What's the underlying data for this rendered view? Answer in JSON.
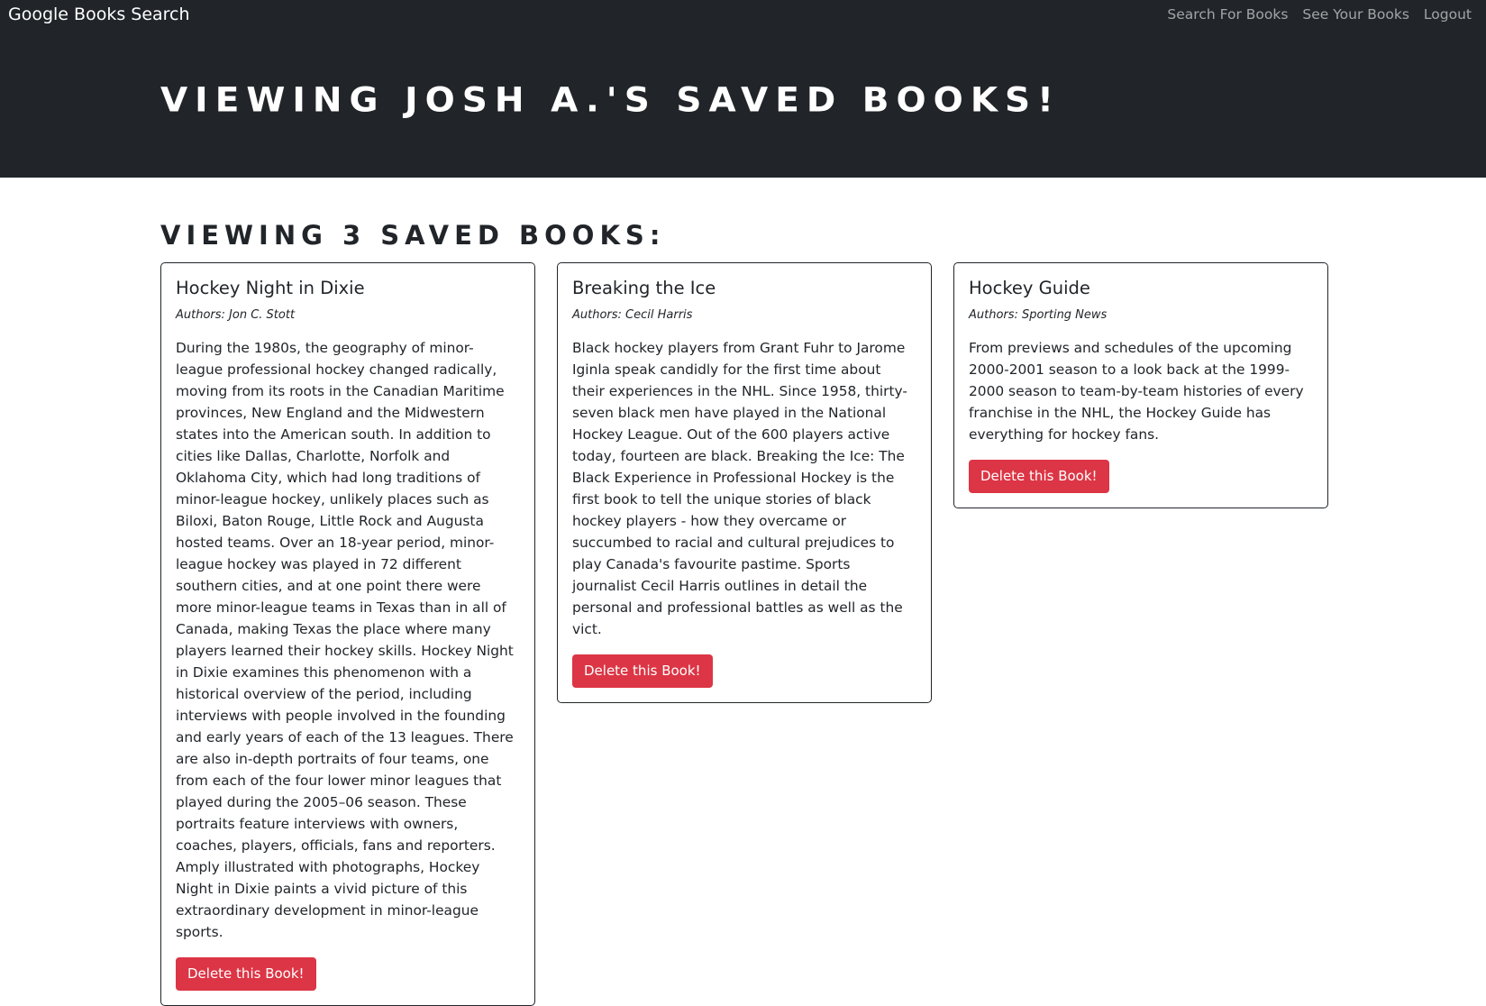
{
  "navbar": {
    "brand": "Google Books Search",
    "links": [
      "Search For Books",
      "See Your Books",
      "Logout"
    ]
  },
  "header": {
    "title": "Viewing Josh A.'s saved books!"
  },
  "main": {
    "count_title": "Viewing 3 saved books:",
    "books": [
      {
        "title": "Hockey Night in Dixie",
        "authors": "Authors: Jon C. Stott",
        "description": "During the 1980s, the geography of minor-league professional hockey changed radically, moving from its roots in the Canadian Maritime provinces, New England and the Midwestern states into the American south. In addition to cities like Dallas, Charlotte, Norfolk and Oklahoma City, which had long traditions of minor-league hockey, unlikely places such as Biloxi, Baton Rouge, Little Rock and Augusta hosted teams. Over an 18-year period, minor-league hockey was played in 72 different southern cities, and at one point there were more minor-league teams in Texas than in all of Canada, making Texas the place where many players learned their hockey skills. Hockey Night in Dixie examines this phenomenon with a historical overview of the period, including interviews with people involved in the founding and early years of each of the 13 leagues. There are also in-depth portraits of four teams, one from each of the four lower minor leagues that played during the 2005–06 season. These portraits feature interviews with owners, coaches, players, officials, fans and reporters. Amply illustrated with photographs, Hockey Night in Dixie paints a vivid picture of this extraordinary development in minor-league sports.",
        "delete_label": "Delete this Book!"
      },
      {
        "title": "Breaking the Ice",
        "authors": "Authors: Cecil Harris",
        "description": "Black hockey players from Grant Fuhr to Jarome Iginla speak candidly for the first time about their experiences in the NHL. Since 1958, thirty-seven black men have played in the National Hockey League. Out of the 600 players active today, fourteen are black. Breaking the Ice: The Black Experience in Professional Hockey is the first book to tell the unique stories of black hockey players - how they overcame or succumbed to racial and cultural prejudices to play Canada's favourite pastime. Sports journalist Cecil Harris outlines in detail the personal and professional battles as well as the vict.",
        "delete_label": "Delete this Book!"
      },
      {
        "title": "Hockey Guide",
        "authors": "Authors: Sporting News",
        "description": "From previews and schedules of the upcoming 2000-2001 season to a look back at the 1999-2000 season to team-by-team histories of every franchise in the NHL, the Hockey Guide has everything for hockey fans.",
        "delete_label": "Delete this Book!"
      }
    ]
  },
  "colors": {
    "dark": "#212529",
    "danger": "#dc3545",
    "nav_link": "#8e9194"
  }
}
